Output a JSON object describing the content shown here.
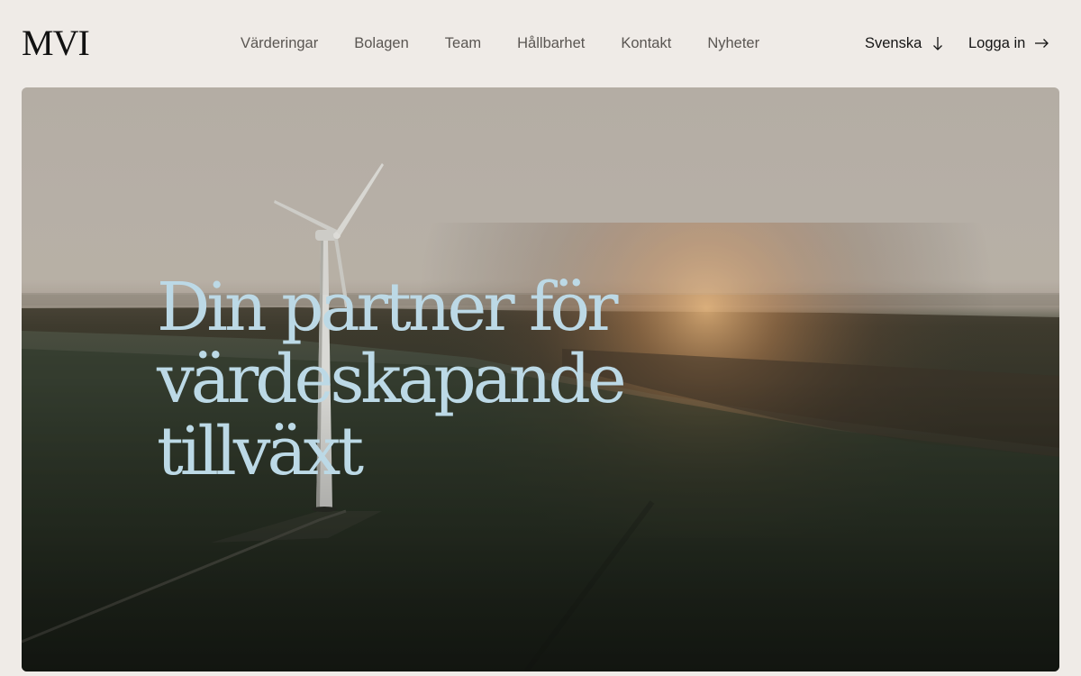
{
  "header": {
    "logo": "MVI",
    "nav": [
      "Värderingar",
      "Bolagen",
      "Team",
      "Hållbarhet",
      "Kontakt",
      "Nyheter"
    ],
    "language": "Svenska",
    "login": "Logga in"
  },
  "hero": {
    "headline_lines": [
      "Din partner för",
      "värdeskapande",
      "tillväxt"
    ]
  },
  "colors": {
    "background": "#efebe7",
    "headline": "#bcd9e6"
  }
}
